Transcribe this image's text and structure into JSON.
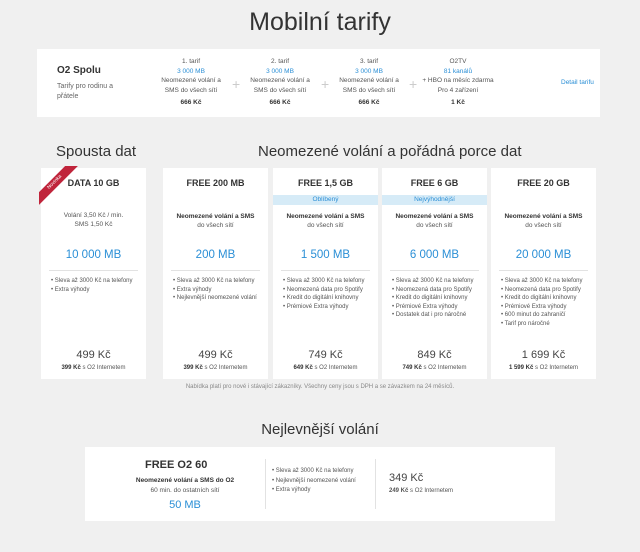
{
  "page_title": "Mobilní tarify",
  "spolu": {
    "name": "O2 Spolu",
    "desc": "Tarify pro rodinu a přátele",
    "tarifs": [
      {
        "head": "1. tarif",
        "mb": "3 000 MB",
        "l1": "Neomezené volání a",
        "l2": "SMS do všech sítí",
        "price": "666 Kč"
      },
      {
        "head": "2. tarif",
        "mb": "3 000 MB",
        "l1": "Neomezené volání a",
        "l2": "SMS do všech sítí",
        "price": "666 Kč"
      },
      {
        "head": "3. tarif",
        "mb": "3 000 MB",
        "l1": "Neomezené volání a",
        "l2": "SMS do všech sítí",
        "price": "666 Kč"
      },
      {
        "head": "O2TV",
        "mb": "81 kanálů",
        "l1": "+ HBO na měsíc zdarma",
        "l2": "Pro 4 zařízení",
        "price": "1 Kč"
      }
    ],
    "plus": "+",
    "detail_link": "Detail tarifu"
  },
  "section_left": "Spousta dat",
  "section_right": "Neomezené volání a pořádná porce dat",
  "cards": [
    {
      "name": "DATA 10 GB",
      "ribbon": "Novinka",
      "badge": "",
      "calls_plain1": "Volání 3,50 Kč / min.",
      "calls_plain2": "SMS 1,50 Kč",
      "data": "10 000 MB",
      "features": [
        "Sleva až 3000 Kč na telefony",
        "Extra výhody"
      ],
      "price": "499 Kč",
      "sub_bold": "399 Kč",
      "sub_rest": " s O2 Internetem"
    },
    {
      "name": "FREE 200 MB",
      "badge": "",
      "calls": "Neomezené volání a SMS",
      "calls2": "do všech sítí",
      "data": "200 MB",
      "features": [
        "Sleva až 3000 Kč na telefony",
        "Extra výhody",
        "Nejlevnější neomezené volání"
      ],
      "price": "499 Kč",
      "sub_bold": "399 Kč",
      "sub_rest": " s O2 Internetem"
    },
    {
      "name": "FREE 1,5 GB",
      "badge": "Oblíbený",
      "calls": "Neomezené volání a SMS",
      "calls2": "do všech sítí",
      "data": "1 500 MB",
      "features": [
        "Sleva až 3000 Kč na telefony",
        "Neomezená data pro Spotify",
        "Kredit do digitální knihovny",
        "Prémiové Extra výhody"
      ],
      "price": "749 Kč",
      "sub_bold": "649 Kč",
      "sub_rest": " s O2 Internetem"
    },
    {
      "name": "FREE 6 GB",
      "badge": "Nejvýhodnější",
      "calls": "Neomezené volání a SMS",
      "calls2": "do všech sítí",
      "data": "6 000 MB",
      "features": [
        "Sleva až 3000 Kč na telefony",
        "Neomezená data pro Spotify",
        "Kredit do digitální knihovny",
        "Prémiové Extra výhody",
        "Dostatek dat i pro náročné"
      ],
      "price": "849 Kč",
      "sub_bold": "749 Kč",
      "sub_rest": " s O2 Internetem"
    },
    {
      "name": "FREE 20 GB",
      "badge": "",
      "calls": "Neomezené volání a SMS",
      "calls2": "do všech sítí",
      "data": "20 000 MB",
      "features": [
        "Sleva až 3000 Kč na telefony",
        "Neomezená data pro Spotify",
        "Kredit do digitální knihovny",
        "Prémiové Extra výhody",
        "600 minut do zahraničí",
        "Tarif pro náročné"
      ],
      "price": "1 699 Kč",
      "sub_bold": "1 599 Kč",
      "sub_rest": " s O2 Internetem"
    }
  ],
  "note": "Nabídka platí pro nové i stávající zákazníky. Všechny ceny jsou s DPH a se závazkem na 24 měsíců.",
  "nej_title": "Nejlevnější volání",
  "nej": {
    "name": "FREE O2 60",
    "calls": "Neomezené volání a SMS do O2",
    "calls2": "60 min. do ostatních sítí",
    "data": "50 MB",
    "features": [
      "Sleva až 3000 Kč na telefony",
      "Nejlevnější neomezené volání",
      "Extra výhody"
    ],
    "price": "349 Kč",
    "sub_bold": "249 Kč",
    "sub_rest": " s O2 Internetem"
  },
  "colors": {
    "accent": "#2b8fd6",
    "ribbon": "#c0243b",
    "badge_bg": "#d6ebf7"
  }
}
